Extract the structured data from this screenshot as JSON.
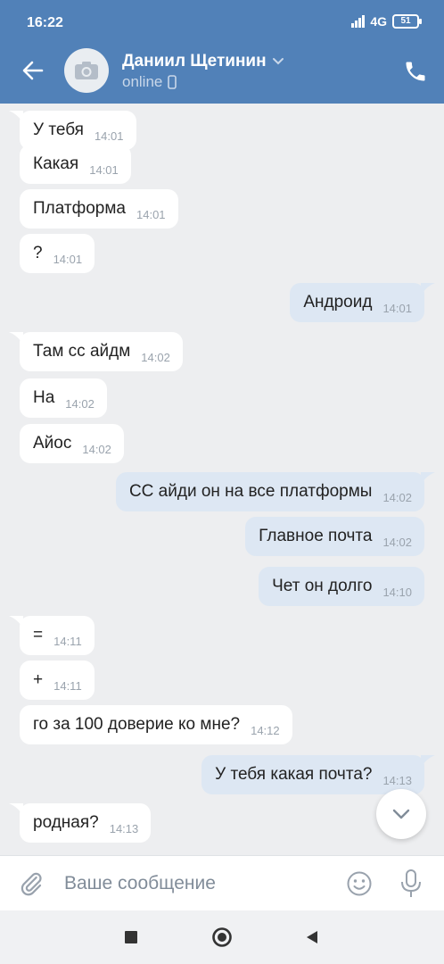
{
  "status_bar": {
    "time": "16:22",
    "network": "4G",
    "battery": "51"
  },
  "header": {
    "contact_name": "Даниил Щетинин",
    "status": "online"
  },
  "messages": [
    {
      "dir": "in",
      "text": "У тебя",
      "time": "14:01"
    },
    {
      "dir": "in",
      "text": "Какая",
      "time": "14:01"
    },
    {
      "dir": "in",
      "text": "Платформа",
      "time": "14:01"
    },
    {
      "dir": "in",
      "text": "?",
      "time": "14:01"
    },
    {
      "dir": "out",
      "text": "Андроид",
      "time": "14:01"
    },
    {
      "dir": "in",
      "text": "Там сс айдм",
      "time": "14:02"
    },
    {
      "dir": "in",
      "text": "На",
      "time": "14:02"
    },
    {
      "dir": "in",
      "text": "Айос",
      "time": "14:02"
    },
    {
      "dir": "out",
      "text": "СС айди он на все платформы",
      "time": "14:02"
    },
    {
      "dir": "out",
      "text": "Главное почта",
      "time": "14:02"
    },
    {
      "dir": "out",
      "text": "Чет он долго",
      "time": "14:10"
    },
    {
      "dir": "in",
      "text": "=",
      "time": "14:11"
    },
    {
      "dir": "in",
      "text": "+",
      "time": "14:11"
    },
    {
      "dir": "in",
      "text": "го за 100 доверие ко мне?",
      "time": "14:12"
    },
    {
      "dir": "out",
      "text": "У тебя какая почта?",
      "time": "14:13"
    },
    {
      "dir": "in",
      "text": "родная?",
      "time": "14:13"
    }
  ],
  "composer": {
    "placeholder": "Ваше сообщение"
  },
  "icons": {
    "back": "arrow-left-icon",
    "avatar": "camera-icon",
    "call": "phone-icon",
    "attach": "paperclip-icon",
    "emoji": "smile-icon",
    "mic": "microphone-icon",
    "scroll": "chevron-down-icon",
    "nav_recent": "square-icon",
    "nav_home": "circle-icon",
    "nav_back": "triangle-icon"
  },
  "colors": {
    "header": "#5181b8",
    "incoming_bubble": "#ffffff",
    "outgoing_bubble": "#dde7f3",
    "background": "#edeef0"
  }
}
